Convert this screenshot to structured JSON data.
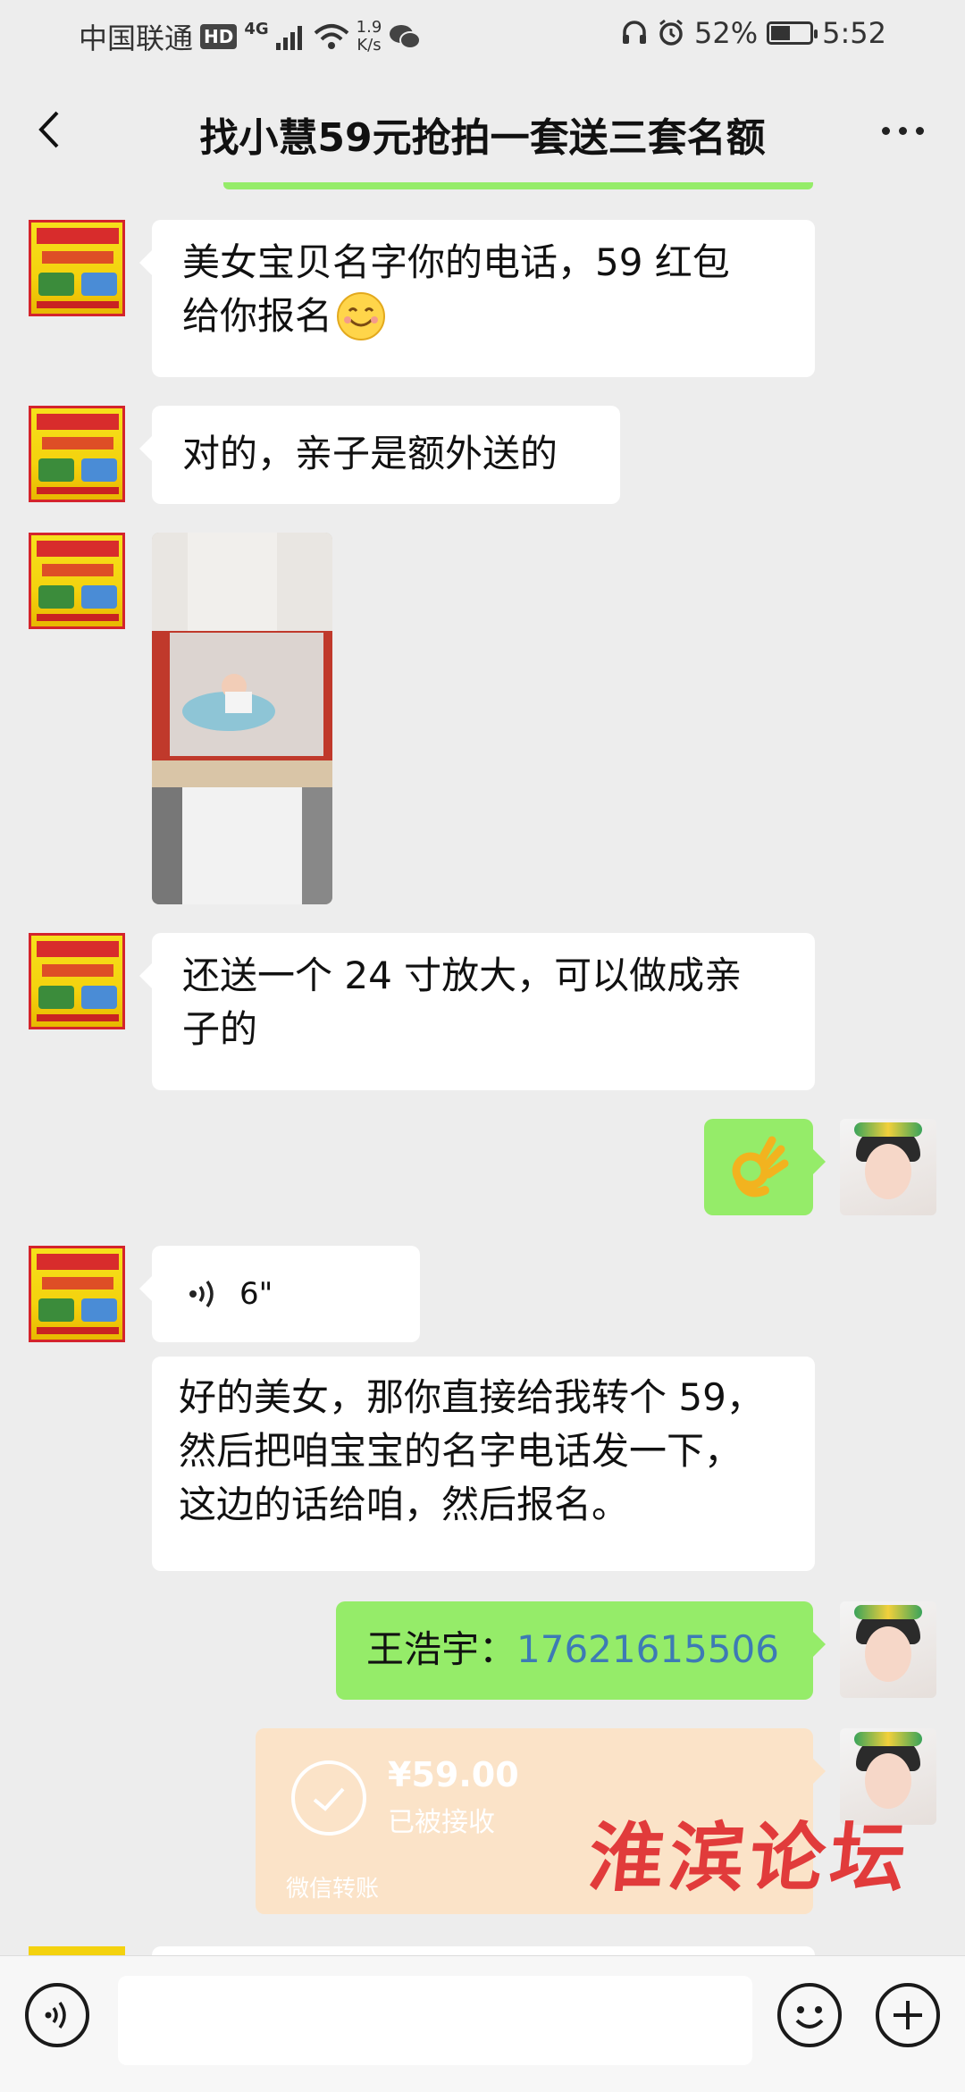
{
  "status_bar": {
    "carrier": "中国联通",
    "hd": "HD",
    "network": "4G",
    "speed_value": "1.9",
    "speed_unit": "K/s",
    "battery": "52%",
    "battery_level": 0.52,
    "time": "5:52"
  },
  "header": {
    "title": "找小慧59元抢拍一套送三套名额"
  },
  "messages": [
    {
      "side": "left",
      "type": "text",
      "lines": [
        "美女宝贝名字你的电话，59 红包",
        "给你报名"
      ],
      "emoji": "smile"
    },
    {
      "side": "left",
      "type": "text",
      "text": "对的，亲子是额外送的"
    },
    {
      "side": "left",
      "type": "image"
    },
    {
      "side": "left",
      "type": "text",
      "lines": [
        "还送一个 24 寸放大，可以做成亲",
        "子的"
      ]
    },
    {
      "side": "right",
      "type": "emoji",
      "emoji": "ok-hand"
    },
    {
      "side": "left",
      "type": "voice",
      "duration": "6\""
    },
    {
      "side": "left",
      "type": "text",
      "lines": [
        "好的美女，那你直接给我转个 59，",
        "然后把咱宝宝的名字电话发一下，",
        "这边的话给咱，然后报名。"
      ]
    },
    {
      "side": "right",
      "type": "text",
      "name": "王浩宇：",
      "phone": "17621615506"
    },
    {
      "side": "right",
      "type": "transfer",
      "amount": "¥59.00",
      "status": "已被接收",
      "footer": "微信转账"
    }
  ],
  "watermark": "淮滨论坛",
  "colors": {
    "background": "#ededed",
    "bubble_self": "#95ec69",
    "bubble_other": "#ffffff",
    "transfer": "#fbe3c8",
    "link": "#3d7ab5",
    "watermark": "#e13b3b"
  }
}
